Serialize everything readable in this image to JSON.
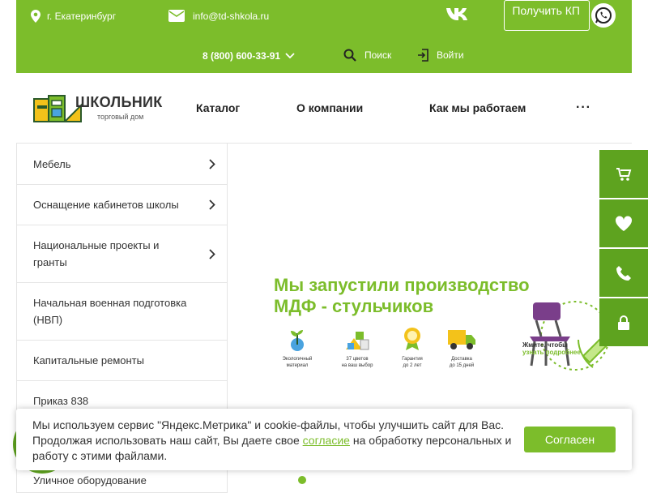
{
  "topbar": {
    "city": "г. Екатеринбург",
    "email": "info@td-shkola.ru",
    "vk_label": "vk",
    "kp_button": "Получить КП",
    "phone": "8 (800) 600-33-91",
    "search": "Поиск",
    "login": "Войти",
    "accent_color": "#7cbd2b"
  },
  "header": {
    "logo_title": "ШКОЛЬНИК",
    "logo_subtitle": "торговый дом",
    "nav": [
      "Каталог",
      "О компании",
      "Как мы работаем",
      "···"
    ]
  },
  "sidebar": {
    "items": [
      {
        "label": "Мебель",
        "arrow": true
      },
      {
        "label": "Оснащение кабинетов школы",
        "arrow": true
      },
      {
        "label": "Национальные проекты и гранты",
        "arrow": true
      },
      {
        "label": "Начальная военная подготовка (НВП)",
        "arrow": false
      },
      {
        "label": "Капитальные ремонты",
        "arrow": false
      },
      {
        "label": "Приказ 838",
        "arrow": false
      },
      {
        "label": "Уличное оборудование",
        "arrow": false
      }
    ]
  },
  "banner": {
    "title_line1": "Мы запустили производство",
    "title_line2": "МДФ - стульчиков",
    "features": [
      {
        "line1": "Экологичный",
        "line2": "материал"
      },
      {
        "line1": "37 цветов",
        "line2": "на ваш выбор"
      },
      {
        "line1": "Гарантия",
        "line2": "до 2 лет"
      },
      {
        "line1": "Доставка",
        "line2": "до 15 дней"
      }
    ],
    "cta_line1": "Жмите, чтобы",
    "cta_line2": "узнать подробнее"
  },
  "floating": [
    "cart-icon",
    "heart-icon",
    "phone-icon",
    "lock-icon"
  ],
  "cookie": {
    "text_before": "Мы используем сервис \"Яндекс.Метрика\" и cookie-файлы, чтобы улучшить сайт для Вас. Продолжая использовать наш сайт, Вы даете свое ",
    "link": "согласие",
    "text_after": " на обработку персональных и работу с этими файлами.",
    "button": "Согласен"
  }
}
